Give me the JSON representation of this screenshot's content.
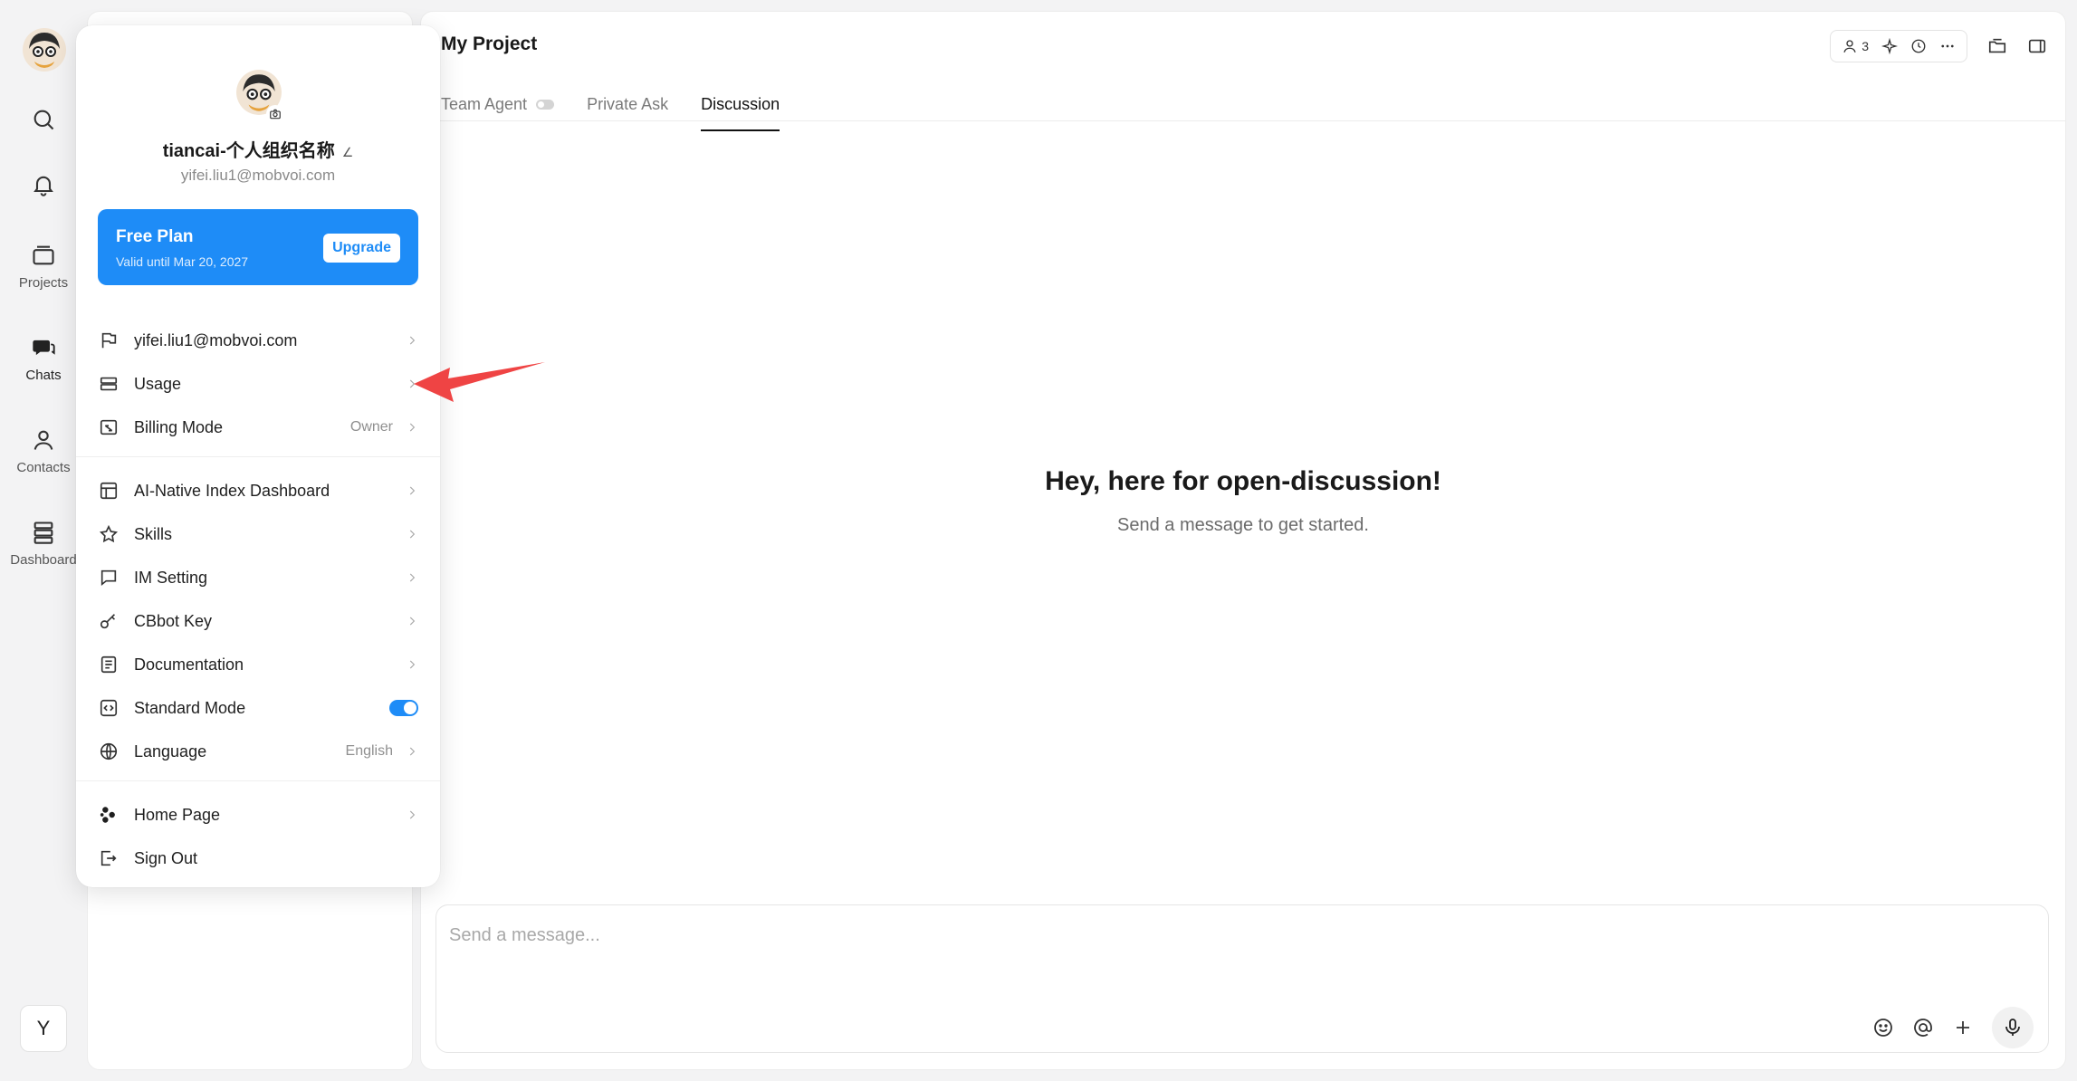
{
  "rail": {
    "items": [
      {
        "label": "",
        "icon": "search-icon"
      },
      {
        "label": "",
        "icon": "bell-icon"
      },
      {
        "label": "Projects",
        "icon": "folder-icon"
      },
      {
        "label": "Chats",
        "icon": "chat-bubble-icon"
      },
      {
        "label": "Contacts",
        "icon": "user-icon"
      },
      {
        "label": "Dashboard",
        "icon": "database-icon"
      }
    ],
    "user_initial": "Y"
  },
  "main": {
    "title": "My Project",
    "member_count": "3",
    "tabs": [
      {
        "label": "Team Agent",
        "active": false
      },
      {
        "label": "Private Ask",
        "active": false
      },
      {
        "label": "Discussion",
        "active": true
      }
    ],
    "empty_title": "Hey, here for open-discussion!",
    "empty_subtitle": "Send a message to get started.",
    "composer_placeholder": "Send a message..."
  },
  "popover": {
    "name": "tiancai-个人组织名称",
    "email": "yifei.liu1@mobvoi.com",
    "plan": {
      "name": "Free Plan",
      "valid": "Valid until Mar 20, 2027",
      "button": "Upgrade",
      "color": "#1e8cf7"
    },
    "group1": [
      {
        "label": "yifei.liu1@mobvoi.com",
        "value": "",
        "icon": "flag-icon"
      },
      {
        "label": "Usage",
        "value": "",
        "icon": "storage-icon"
      },
      {
        "label": "Billing Mode",
        "value": "Owner",
        "icon": "billing-icon"
      }
    ],
    "group2": [
      {
        "label": "AI-Native Index Dashboard",
        "value": "",
        "icon": "layout-icon"
      },
      {
        "label": "Skills",
        "value": "",
        "icon": "star-icon"
      },
      {
        "label": "IM Setting",
        "value": "",
        "icon": "message-square-icon"
      },
      {
        "label": "CBbot Key",
        "value": "",
        "icon": "key-icon"
      },
      {
        "label": "Documentation",
        "value": "",
        "icon": "document-icon"
      },
      {
        "label": "Standard Mode",
        "value": "",
        "icon": "code-icon",
        "toggle": true
      },
      {
        "label": "Language",
        "value": "English",
        "icon": "globe-icon"
      }
    ],
    "group3": [
      {
        "label": "Home Page",
        "value": "",
        "icon": "logo-icon"
      },
      {
        "label": "Sign Out",
        "value": "",
        "icon": "sign-out-icon"
      }
    ]
  },
  "annotation": {
    "arrow_color": "#ef4444"
  }
}
